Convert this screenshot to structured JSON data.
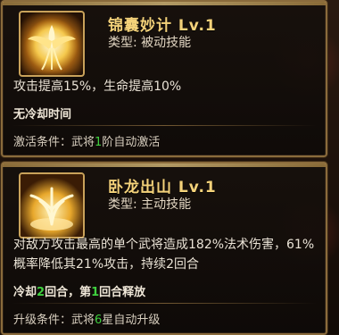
{
  "colors": {
    "title": "#f4d27a",
    "highlight": "#3fd03f",
    "border": "#8a6b3c"
  },
  "skills": [
    {
      "icon": "phoenix-icon",
      "name": "锦囊妙计 Lv.1",
      "type_label": "类型: 被动技能",
      "description": "攻击提高15%，生命提高10%",
      "cooldown_text": "无冷却时间",
      "condition_prefix": "激活条件：武将",
      "condition_value": "1",
      "condition_unit": "阶",
      "condition_suffix": "自动激活"
    },
    {
      "icon": "golden-tree-icon",
      "name": "卧龙出山 Lv.1",
      "type_label": "类型: 主动技能",
      "description": "对敌方攻击最高的单个武将造成182%法术伤害，61%概率降低其21%攻击，持续2回合",
      "cooldown_prefix": "冷却",
      "cooldown_value": "2",
      "cooldown_mid": "回合，第",
      "cooldown_value2": "1",
      "cooldown_suffix": "回合释放",
      "condition_prefix": "升级条件：武将",
      "condition_value": "6",
      "condition_unit": "星",
      "condition_suffix": "自动升级"
    }
  ]
}
